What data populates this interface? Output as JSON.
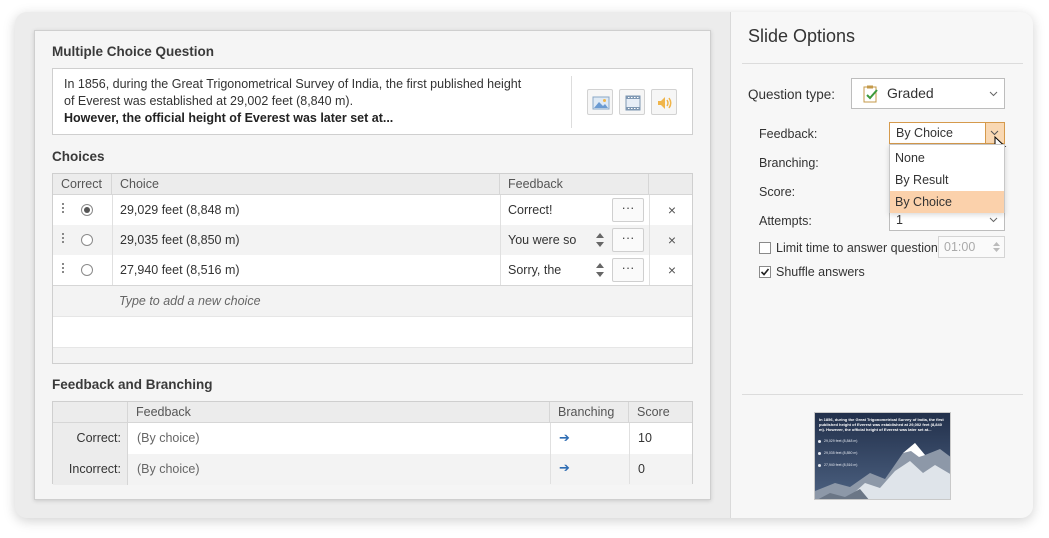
{
  "editor": {
    "title": "Multiple Choice Question",
    "question": {
      "line1": "In 1856, during the Great Trigonometrical Survey of India, the first published height",
      "line2": "of Everest was established at 29,002 feet (8,840 m).",
      "line3": "However, the official height of Everest was later set at..."
    },
    "media_buttons": [
      {
        "name": "picture-icon"
      },
      {
        "name": "video-icon"
      },
      {
        "name": "audio-icon"
      }
    ],
    "choices_title": "Choices",
    "choices_table": {
      "headers": [
        "Correct",
        "Choice",
        "Feedback"
      ],
      "rows": [
        {
          "correct": true,
          "choice": "29,029 feet (8,848 m)",
          "feedback": "Correct!"
        },
        {
          "correct": false,
          "choice": "29,035 feet (8,850 m)",
          "feedback": "You were so"
        },
        {
          "correct": false,
          "choice": "27,940 feet (8,516 m)",
          "feedback": "Sorry, the"
        }
      ],
      "more_label": "···",
      "delete_label": "×",
      "add_placeholder": "Type to add a new choice"
    },
    "feedback_title": "Feedback and Branching",
    "feedback_table": {
      "headers": [
        "Feedback",
        "Branching",
        "Score"
      ],
      "rows": [
        {
          "label": "Correct:",
          "feedback": "(By choice)",
          "branch_icon": "arrow-right-icon",
          "score": "10"
        },
        {
          "label": "Incorrect:",
          "feedback": "(By choice)",
          "branch_icon": "arrow-right-icon",
          "score": "0"
        }
      ]
    }
  },
  "options": {
    "title": "Slide Options",
    "question_type_label": "Question type:",
    "question_type_value": "Graded",
    "feedback_label": "Feedback:",
    "feedback_value": "By Choice",
    "feedback_options": [
      "None",
      "By Result",
      "By Choice"
    ],
    "feedback_selected": "By Choice",
    "branching_label": "Branching:",
    "score_label": "Score:",
    "attempts_label": "Attempts:",
    "attempts_value": "1",
    "limit_time_label": "Limit time to answer question:",
    "limit_time_checked": false,
    "limit_time_value": "01:00",
    "shuffle_label": "Shuffle answers",
    "shuffle_checked": true
  },
  "colors": {
    "accent": "#d59a4c",
    "dropdown_selected": "#fbd1ab",
    "link_arrow": "#2d6cb3"
  }
}
